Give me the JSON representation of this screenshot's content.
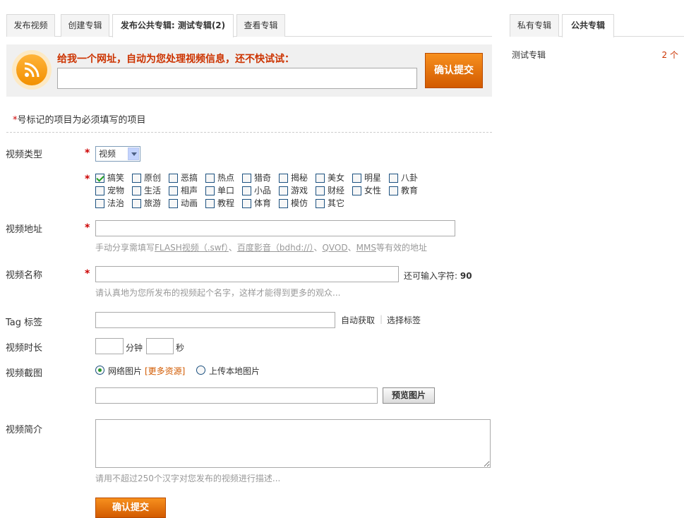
{
  "tabs": [
    {
      "label": "发布视频"
    },
    {
      "label": "创建专辑"
    },
    {
      "label": "发布公共专辑: 测试专辑(2)"
    },
    {
      "label": "查看专辑"
    }
  ],
  "right_tabs": [
    {
      "label": "私有专辑"
    },
    {
      "label": "公共专辑"
    }
  ],
  "sidebar": {
    "album_name": "测试专辑",
    "album_count": "2 个"
  },
  "submit_box": {
    "prompt": "给我一个网址，自动为您处理视频信息，还不快试试：",
    "url_value": "",
    "confirm_label": "确认提交"
  },
  "required_note": {
    "star": "*",
    "text": "号标记的项目为必须填写的项目"
  },
  "form": {
    "type_label": "视频类型",
    "type_value": "视频",
    "categories": [
      {
        "label": "搞笑",
        "checked": true
      },
      {
        "label": "原创",
        "checked": false
      },
      {
        "label": "恶搞",
        "checked": false
      },
      {
        "label": "热点",
        "checked": false
      },
      {
        "label": "猎奇",
        "checked": false
      },
      {
        "label": "揭秘",
        "checked": false
      },
      {
        "label": "美女",
        "checked": false
      },
      {
        "label": "明星",
        "checked": false
      },
      {
        "label": "八卦",
        "checked": false
      },
      {
        "label": "宠物",
        "checked": false
      },
      {
        "label": "生活",
        "checked": false
      },
      {
        "label": "相声",
        "checked": false
      },
      {
        "label": "单口",
        "checked": false
      },
      {
        "label": "小品",
        "checked": false
      },
      {
        "label": "游戏",
        "checked": false
      },
      {
        "label": "财经",
        "checked": false
      },
      {
        "label": "女性",
        "checked": false
      },
      {
        "label": "教育",
        "checked": false
      },
      {
        "label": "法治",
        "checked": false
      },
      {
        "label": "旅游",
        "checked": false
      },
      {
        "label": "动画",
        "checked": false
      },
      {
        "label": "教程",
        "checked": false
      },
      {
        "label": "体育",
        "checked": false
      },
      {
        "label": "模仿",
        "checked": false
      },
      {
        "label": "其它",
        "checked": false
      }
    ],
    "url_label": "视频地址",
    "url_hint": {
      "prefix": "手动分享需填写",
      "flash": "FLASH视频（.swf）",
      "sep1": "、",
      "baidu": "百度影音（bdhd://）",
      "sep2": "、",
      "qvod": "QVOD",
      "sep3": "、",
      "mms": "MMS",
      "suffix": "等有效的地址"
    },
    "name_label": "视频名称",
    "name_counter_text": "还可输入字符: ",
    "name_counter_value": "90",
    "name_hint": "请认真地为您所发布的视频起个名字，这样才能得到更多的观众...",
    "tag_label": "Tag 标签",
    "tag_auto": "自动获取",
    "tag_choose": "选择标签",
    "duration_label": "视频时长",
    "duration_min_unit": "分钟",
    "duration_sec_unit": "秒",
    "screenshot_label": "视频截图",
    "screenshot_option_web": "网络图片",
    "screenshot_more": "[更多资源]",
    "screenshot_option_upload": "上传本地图片",
    "preview_label": "预览图片",
    "desc_label": "视频简介",
    "desc_hint": "请用不超过250个汉字对您发布的视频进行描述...",
    "submit_label": "确认提交",
    "required_star": "*"
  },
  "colors": {
    "accent": "#d25a00",
    "prompt": "#cc3300",
    "required": "#cc0000"
  }
}
